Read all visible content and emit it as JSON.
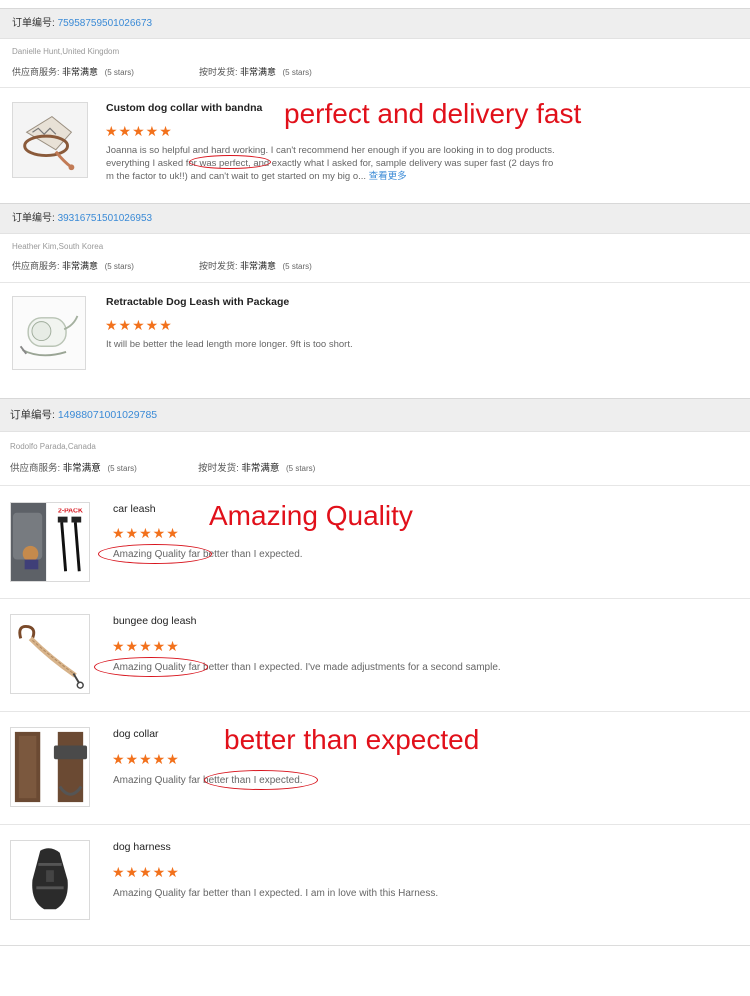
{
  "orders": [
    {
      "label": "订单编号:",
      "number": "75958759501026673",
      "buyer": "Danielle Hunt,United Kingdom",
      "supplier_label": "供应商服务:",
      "supplier_value": "非常满意",
      "supplier_stars": "(5 stars)",
      "delivery_label": "按时发货:",
      "delivery_value": "非常满意",
      "delivery_stars": "(5 stars)",
      "items": [
        {
          "name": "Custom dog collar with bandna",
          "rating": 5,
          "stars": "★★★★★",
          "review_lines": [
            "Joanna is so helpful and hard working. I can't recommend her enough if you are looking in to dog products.",
            "everything I asked for was perfect, and exactly what I asked for, sample delivery was super fast (2 days fro",
            "m the factor to uk!!) and can't wait to get started on my big o..."
          ],
          "more_label": "查看更多",
          "image_icon": "dog-collar-bandana-icon"
        }
      ]
    },
    {
      "label": "订单编号:",
      "number": "39316751501026953",
      "buyer": "Heather Kim,South Korea",
      "supplier_label": "供应商服务:",
      "supplier_value": "非常满意",
      "supplier_stars": "(5 stars)",
      "delivery_label": "按时发货:",
      "delivery_value": "非常满意",
      "delivery_stars": "(5 stars)",
      "items": [
        {
          "name": "Retractable Dog Leash with Package",
          "rating": 5,
          "stars": "★★★★★",
          "review": "It will be better the lead length more longer. 9ft is too short.",
          "image_icon": "retractable-leash-icon"
        }
      ]
    },
    {
      "label": "订单编号:",
      "number": "14988071001029785",
      "buyer": "Rodolfo Parada,Canada",
      "supplier_label": "供应商服务:",
      "supplier_value": "非常满意",
      "supplier_stars": "(5 stars)",
      "delivery_label": "按时发货:",
      "delivery_value": "非常满意",
      "delivery_stars": "(5 stars)",
      "items": [
        {
          "name": "car leash",
          "rating": 5,
          "stars": "★★★★★",
          "review": "Amazing Quality far better than I expected.",
          "image_icon": "car-leash-icon",
          "image_badge": "2-PACK"
        },
        {
          "name": "bungee dog leash",
          "rating": 5,
          "stars": "★★★★★",
          "review": "Amazing Quality far better than I expected. I've made adjustments for a second sample.",
          "image_icon": "bungee-leash-icon"
        },
        {
          "name": "dog collar",
          "rating": 5,
          "stars": "★★★★★",
          "review": "Amazing Quality far better than I expected.",
          "image_icon": "dog-collar-icon"
        },
        {
          "name": "dog harness",
          "rating": 5,
          "stars": "★★★★★",
          "review": "Amazing Quality far better than I expected. I am in love with this Harness.",
          "image_icon": "dog-harness-icon"
        }
      ]
    }
  ],
  "annotations": {
    "first": "perfect and delivery fast",
    "second": "Amazing Quality",
    "third": "better than expected"
  },
  "colors": {
    "accent_link": "#3a8ad6",
    "star": "#f2711c",
    "annotation": "#e1101a",
    "order_bar_bg": "#eeeeee"
  }
}
